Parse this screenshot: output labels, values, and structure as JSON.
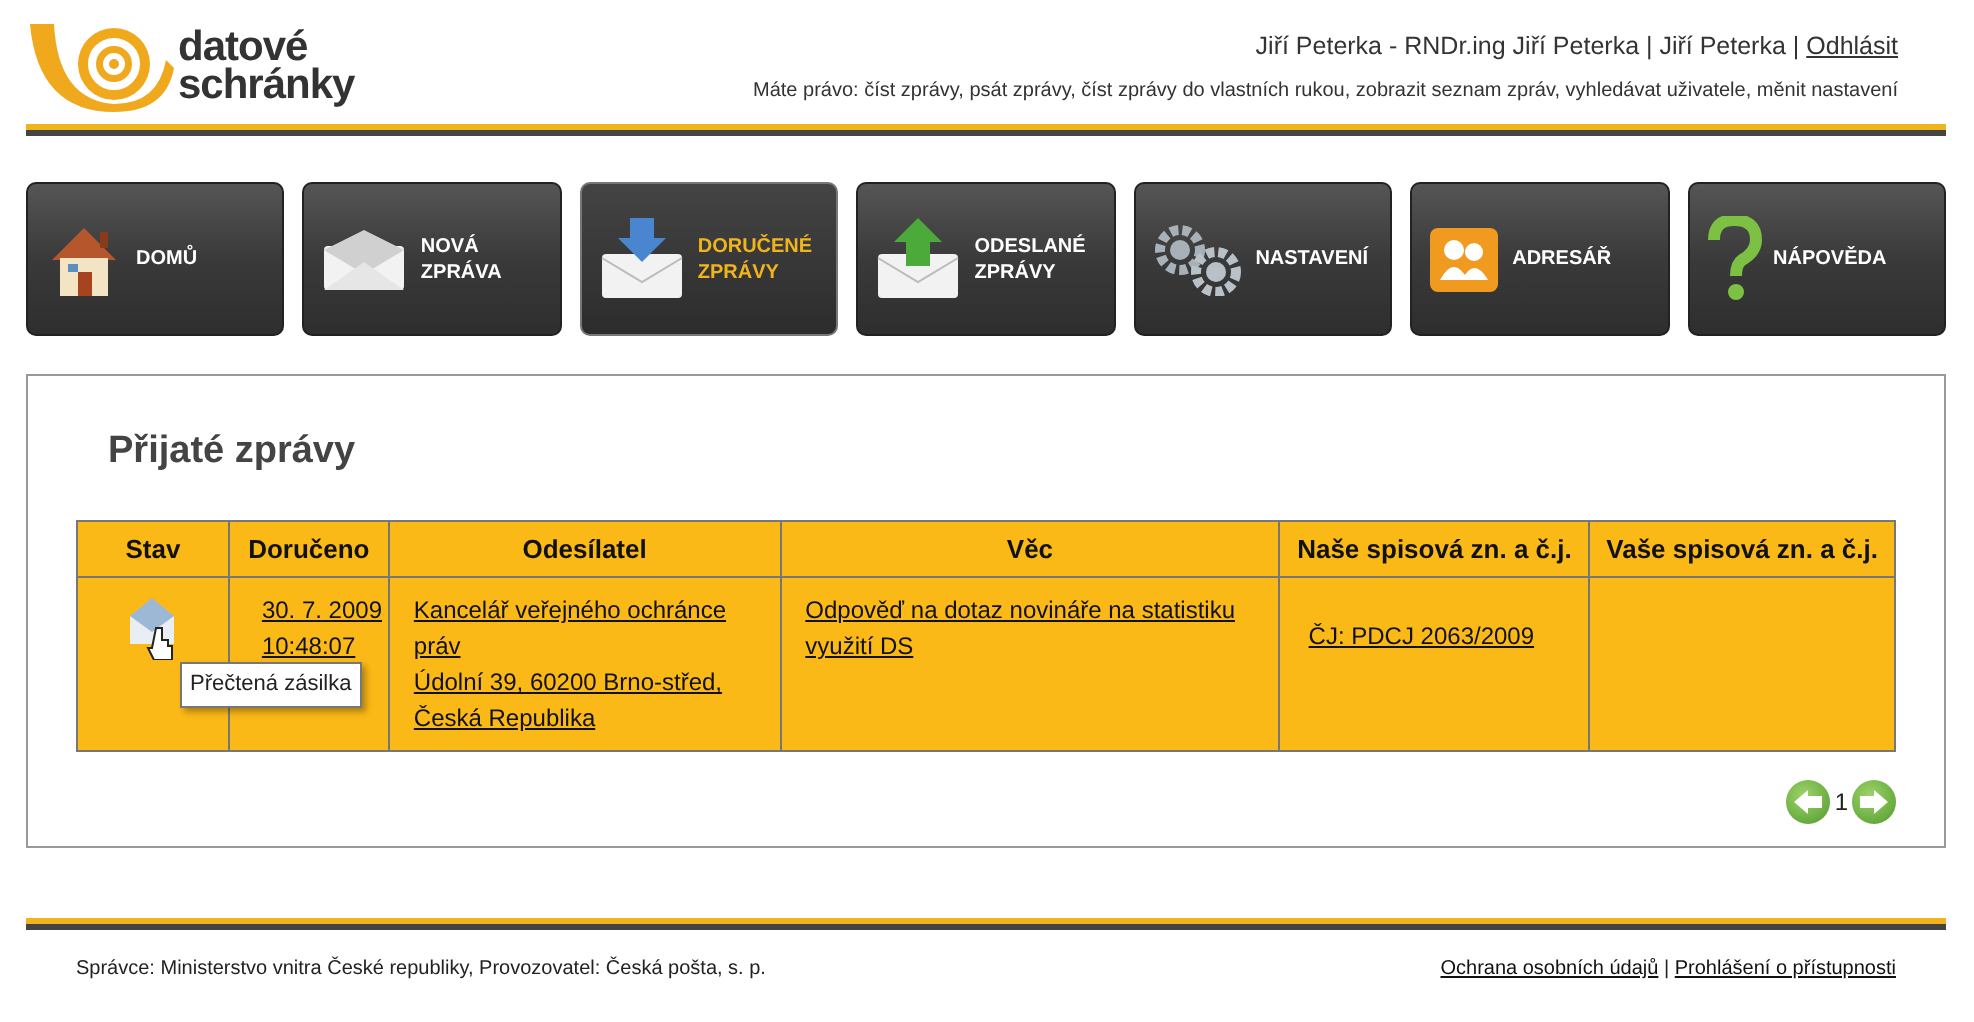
{
  "logo": {
    "line1": "datové",
    "line2": "schránky"
  },
  "user": {
    "text": "Jiří Peterka - RNDr.ing Jiří Peterka | Jiří Peterka |",
    "logout": "Odhlásit"
  },
  "rights": "Máte právo: číst zprávy, psát zprávy, číst zprávy do vlastních rukou, zobrazit seznam zpráv, vyhledávat uživatele, měnit nastavení",
  "nav": [
    {
      "lines": [
        "DOMŮ"
      ],
      "selected": false
    },
    {
      "lines": [
        "NOVÁ",
        "ZPRÁVA"
      ],
      "selected": false
    },
    {
      "lines": [
        "DORUČENÉ",
        "ZPRÁVY"
      ],
      "selected": true
    },
    {
      "lines": [
        "ODESLANÉ",
        "ZPRÁVY"
      ],
      "selected": false
    },
    {
      "lines": [
        "NASTAVENÍ"
      ],
      "selected": false
    },
    {
      "lines": [
        "ADRESÁŘ"
      ],
      "selected": false
    },
    {
      "lines": [
        "NÁPOVĚDA"
      ],
      "selected": false
    }
  ],
  "panel": {
    "title": "Přijaté zprávy",
    "table": {
      "columns": [
        "Stav",
        "Doručeno",
        "Odesílatel",
        "Věc",
        "Naše spisová zn. a č.j.",
        "Vaše spisová zn. a č.j."
      ],
      "rows": [
        {
          "tooltip": "Přečtená zásilka",
          "delivered": [
            "30. 7. 2009",
            "10:48:07"
          ],
          "sender": [
            "Kancelář veřejného ochránce práv",
            "Údolní 39, 60200 Brno-střed, Česká Republika"
          ],
          "subject": "Odpověď na dotaz novináře na statistiku využití DS",
          "our_ref": "ČJ: PDCJ 2063/2009"
        }
      ]
    },
    "pagination": {
      "page": "1"
    }
  },
  "footer": {
    "text": "Správce: Ministerstvo vnitra České republiky, Provozovatel: Česká pošta, s. p.",
    "links": [
      "Ochrana osobních údajů",
      "Prohlášení o přístupnosti"
    ],
    "separator": "|"
  }
}
